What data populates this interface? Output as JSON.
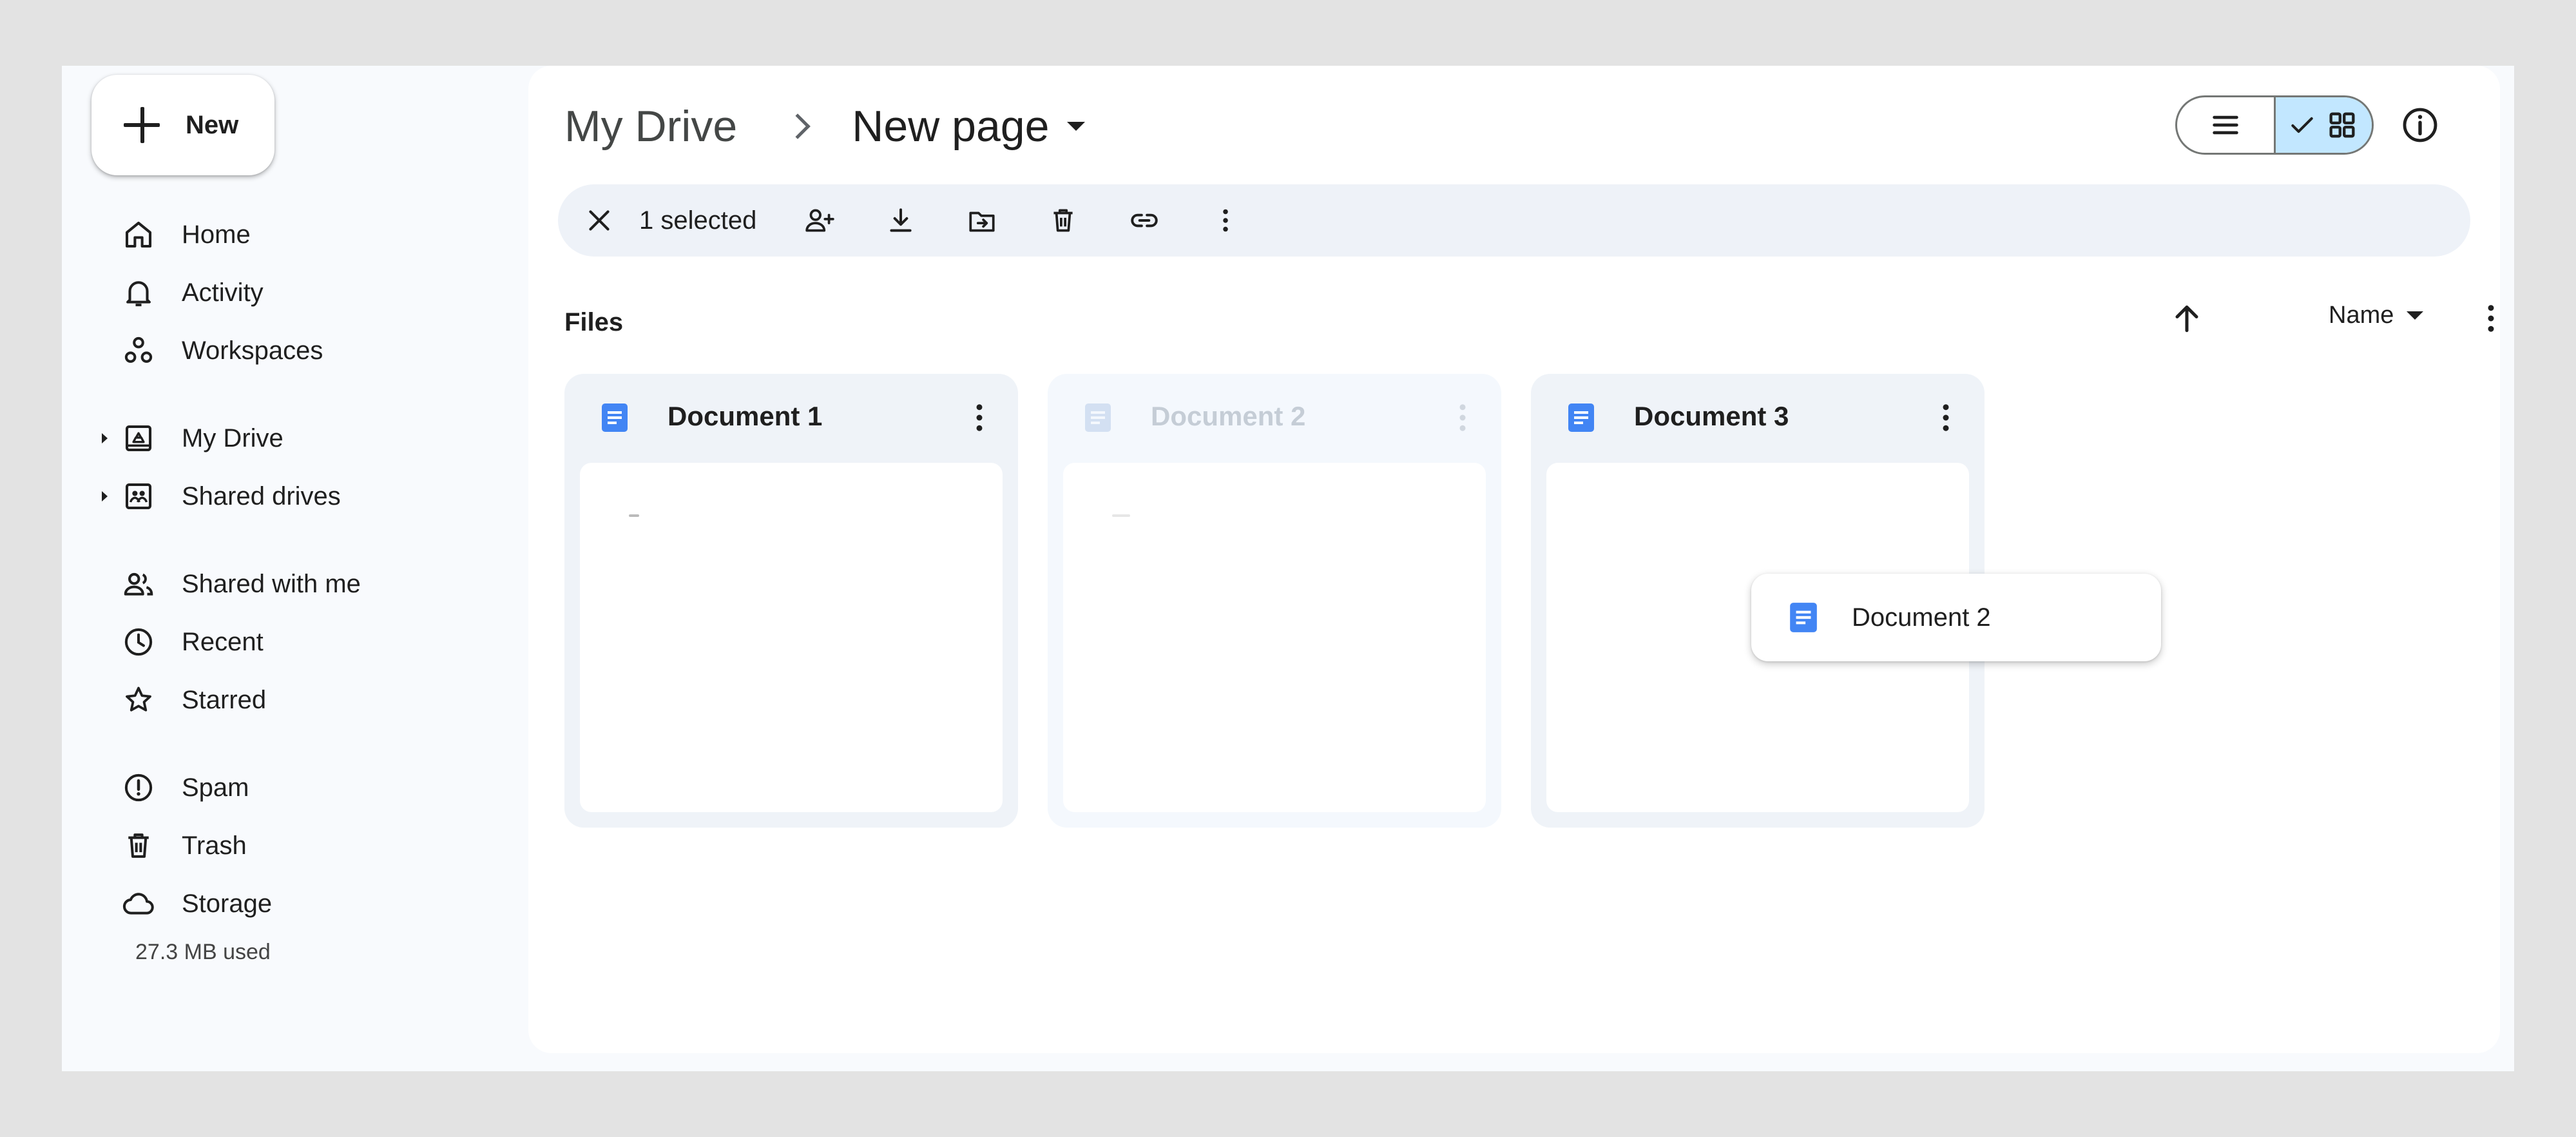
{
  "sidebar": {
    "new_label": "New",
    "items": [
      {
        "label": "Home",
        "icon": "home-icon"
      },
      {
        "label": "Activity",
        "icon": "bell-icon"
      },
      {
        "label": "Workspaces",
        "icon": "workspaces-icon"
      },
      {
        "label": "My Drive",
        "icon": "drive-icon"
      },
      {
        "label": "Shared drives",
        "icon": "shared-drives-icon"
      },
      {
        "label": "Shared with me",
        "icon": "people-icon"
      },
      {
        "label": "Recent",
        "icon": "clock-icon"
      },
      {
        "label": "Starred",
        "icon": "star-icon"
      },
      {
        "label": "Spam",
        "icon": "spam-icon"
      },
      {
        "label": "Trash",
        "icon": "trash-icon"
      },
      {
        "label": "Storage",
        "icon": "cloud-icon"
      }
    ],
    "storage_used": "27.3 MB used"
  },
  "header": {
    "breadcrumb_root": "My Drive",
    "breadcrumb_current": "New page"
  },
  "selection_bar": {
    "count_label": "1 selected"
  },
  "files_section": {
    "title": "Files",
    "sort_label": "Name"
  },
  "files": [
    {
      "name": "Document 1",
      "state": "normal"
    },
    {
      "name": "Document 2",
      "state": "dragging"
    },
    {
      "name": "Document 3",
      "state": "normal"
    }
  ],
  "drag_ghost": {
    "label": "Document 2"
  },
  "colors": {
    "doc_blue": "#4285f4",
    "active_toggle": "#c2e7ff",
    "selection_bar": "#eef2f8"
  }
}
